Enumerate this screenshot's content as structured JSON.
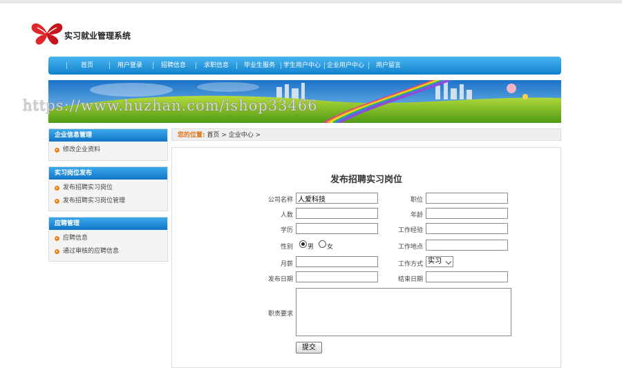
{
  "app": {
    "title": "实习就业管理系统"
  },
  "nav": {
    "items": [
      "首页",
      "用户登录",
      "招聘信息",
      "求职信息",
      "毕业生服务",
      "学生用户中心",
      "企业用户中心",
      "用户留言"
    ]
  },
  "watermark": "https://www.huzhan.com/ishop33466",
  "sidebar": [
    {
      "title": "企业信息管理",
      "items": [
        "修改企业资料"
      ]
    },
    {
      "title": "实习岗位发布",
      "items": [
        "发布招聘实习岗位",
        "发布招聘实习岗位管理"
      ]
    },
    {
      "title": "应聘管理",
      "items": [
        "应聘信息",
        "通过审核的应聘信息"
      ]
    }
  ],
  "breadcrumb": {
    "label": "您的位置:",
    "path": "首页 > 企业中心 >"
  },
  "form": {
    "title": "发布招聘实习岗位",
    "company_label": "公司名称",
    "company_value": "人爱科技",
    "position_label": "职位",
    "position_value": "",
    "headcount_label": "人数",
    "headcount_value": "",
    "age_label": "年龄",
    "age_value": "",
    "education_label": "学历",
    "education_value": "",
    "experience_label": "工作经验",
    "experience_value": "",
    "gender_label": "性别",
    "gender_male": "男",
    "gender_female": "女",
    "gender_selected": "男",
    "location_label": "工作地点",
    "location_value": "",
    "salary_label": "月薪",
    "salary_value": "",
    "worktype_label": "工作方式",
    "worktype_value": "实习",
    "publish_date_label": "发布日期",
    "publish_date_value": "",
    "end_date_label": "结束日期",
    "end_date_value": "",
    "duty_label": "职责要求",
    "submit_label": "提交"
  },
  "colors": {
    "nav_blue": "#1a8ad8",
    "accent_orange": "#e0771b"
  }
}
